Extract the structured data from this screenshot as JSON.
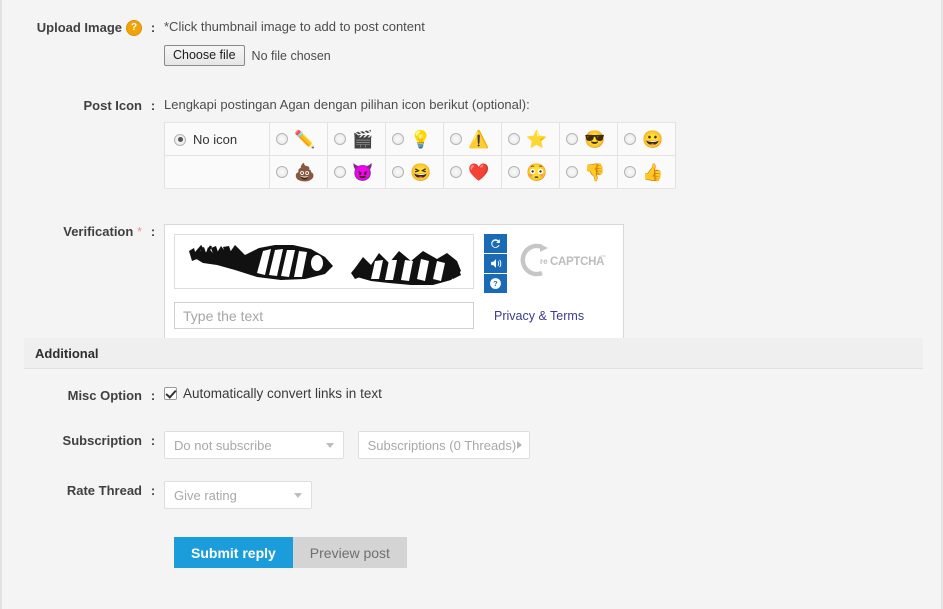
{
  "colors": {
    "page_bg": "#f4f4f4",
    "accent_blue": "#1b9ddb",
    "captcha_btn_blue": "#1a6bb5",
    "help_orange": "#f0a30a",
    "required_red": "#e89a9a",
    "link_indigo": "#3b3b8f"
  },
  "upload_image": {
    "label": "Upload Image",
    "help_icon": "help-circle-icon",
    "colon": ":",
    "hint": "*Click thumbnail image to add to post content",
    "choose_file_label": "Choose file",
    "no_file_text": "No file chosen"
  },
  "post_icon": {
    "label": "Post Icon",
    "colon": ":",
    "hint": "Lengkapi postingan Agan dengan pilihan icon berikut (optional):",
    "no_icon_label": "No icon",
    "no_icon_selected": true,
    "rows": [
      [
        {
          "icon": "pencil-icon",
          "glyph": "✏️",
          "selected": false
        },
        {
          "icon": "clapperboard-icon",
          "glyph": "🎬",
          "selected": false
        },
        {
          "icon": "lightbulb-icon",
          "glyph": "💡",
          "selected": false
        },
        {
          "icon": "warning-triangle-icon",
          "glyph": "⚠️",
          "selected": false
        },
        {
          "icon": "star-icon",
          "glyph": "⭐",
          "selected": false
        },
        {
          "icon": "sunglasses-face-icon",
          "glyph": "😎",
          "selected": false
        },
        {
          "icon": "smiling-face-icon",
          "glyph": "😀",
          "selected": false
        }
      ],
      [
        {
          "icon": "poop-icon",
          "glyph": "💩",
          "selected": false
        },
        {
          "icon": "devil-face-icon",
          "glyph": "😈",
          "selected": false
        },
        {
          "icon": "laughing-face-icon",
          "glyph": "😆",
          "selected": false
        },
        {
          "icon": "heart-icon",
          "glyph": "❤️",
          "selected": false
        },
        {
          "icon": "blue-face-icon",
          "glyph": "😳",
          "selected": false
        },
        {
          "icon": "thumbs-down-icon",
          "glyph": "👎",
          "selected": false
        },
        {
          "icon": "thumbs-up-icon",
          "glyph": "👍",
          "selected": false
        }
      ]
    ]
  },
  "verification": {
    "label": "Verification",
    "required_mark": "*",
    "colon": ":",
    "captcha_image_alt": "recaptcha-distorted-text",
    "captcha_words": [
      "ultra",
      "master"
    ],
    "input_placeholder": "Type the text",
    "input_value": "",
    "controls": [
      {
        "name": "refresh-captcha-button",
        "icon": "refresh-icon"
      },
      {
        "name": "audio-captcha-button",
        "icon": "speaker-icon"
      },
      {
        "name": "captcha-help-button",
        "icon": "question-mark-icon"
      }
    ],
    "brand": {
      "prefix": "re",
      "name": "CAPTCHA",
      "tm": "™"
    },
    "privacy_link": "Privacy & Terms"
  },
  "additional": {
    "section_title": "Additional",
    "misc_option": {
      "label": "Misc Option",
      "colon": ":",
      "checkbox_label": "Automatically convert links in text",
      "checked": true
    },
    "subscription": {
      "label": "Subscription",
      "colon": ":",
      "select_value": "Do not subscribe",
      "button_label": "Subscriptions (0 Threads)"
    },
    "rate_thread": {
      "label": "Rate Thread",
      "colon": ":",
      "select_value": "Give rating"
    }
  },
  "actions": {
    "submit_label": "Submit reply",
    "preview_label": "Preview post"
  }
}
